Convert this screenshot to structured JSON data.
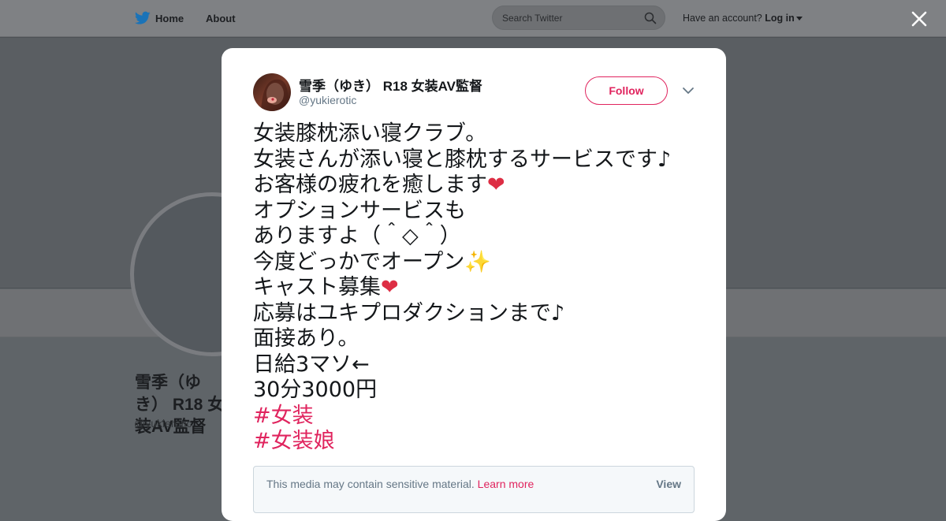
{
  "topbar": {
    "home_label": "Home",
    "about_label": "About",
    "search_placeholder": "Search Twitter",
    "have_account": "Have an account?",
    "login_label": "Log in"
  },
  "profile": {
    "name": "雪季（ゆき） R18 女装AV監督",
    "handle": "@yukierotic"
  },
  "tweet": {
    "author_name": "雪季（ゆき） R18 女装AV監督",
    "author_handle": "@yukierotic",
    "follow_label": "Follow",
    "lines": [
      "女装膝枕添い寝クラブ。",
      "女装さんが添い寝と膝枕するサービスです♪",
      "お客様の疲れを癒します",
      "オプションサービスも",
      "ありますよ（＾◇＾）",
      "今度どっかでオープン",
      "キャスト募集",
      "応募はユキプロダクションまで♪",
      "面接あり。",
      "日給3マソ←",
      "30分3000円"
    ],
    "emojis": {
      "heart": "❤",
      "sparkles": "✨"
    },
    "hashtags": [
      "#女装",
      "#女装娘"
    ],
    "sensitive_notice": "This media may contain sensitive material.",
    "learn_more": "Learn more",
    "view_label": "View"
  },
  "icons": {
    "logo": "twitter-bird-icon",
    "search": "search-icon",
    "close": "close-icon",
    "more": "chevron-down-icon"
  },
  "colors": {
    "accent": "#e0245e",
    "text": "#14171a",
    "muted": "#657786"
  }
}
